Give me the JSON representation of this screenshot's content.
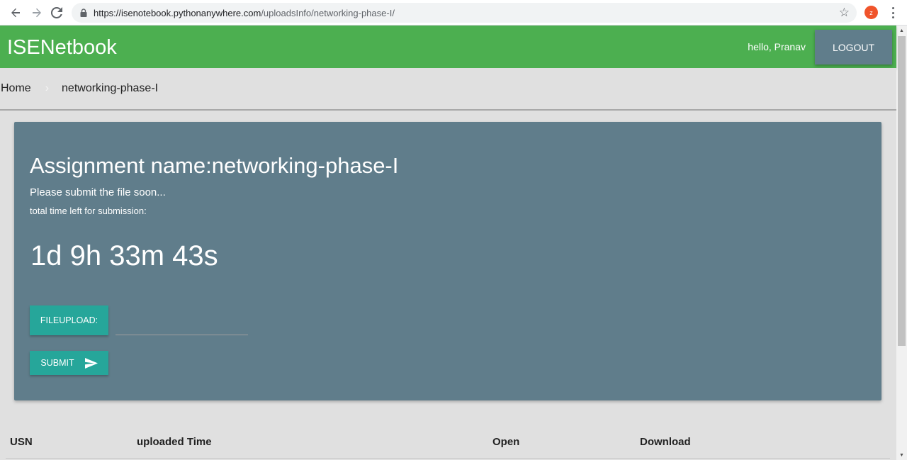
{
  "browser": {
    "url_host": "https://isenotebook.pythonanywhere.com",
    "url_path": "/uploadsInfo/networking-phase-I/",
    "profile_initial": "z"
  },
  "header": {
    "brand": "ISENetbook",
    "greeting": "hello, Pranav",
    "logout_label": "LOGOUT"
  },
  "breadcrumb": {
    "home": "Home",
    "current": "networking-phase-I"
  },
  "card": {
    "title": "Assignment name:networking-phase-I",
    "subtitle": "Please submit the file soon...",
    "time_label": "total time left for submission:",
    "countdown": "1d 9h 33m 43s",
    "file_button_label": "FILEUPLOAD:",
    "submit_label": "SUBMIT"
  },
  "table": {
    "columns": [
      "USN",
      "uploaded Time",
      "Open",
      "Download"
    ]
  },
  "colors": {
    "header_green": "#4caf50",
    "card_blue_grey": "#607d8b",
    "teal_button": "#26a69a"
  },
  "icons": {
    "back": "arrow-left-icon",
    "forward": "arrow-right-icon",
    "reload": "reload-icon",
    "lock": "lock-icon",
    "bookmark": "star-icon",
    "menu": "kebab-menu-icon",
    "submit": "send-icon",
    "breadcrumb_sep": "chevron-right-icon"
  }
}
